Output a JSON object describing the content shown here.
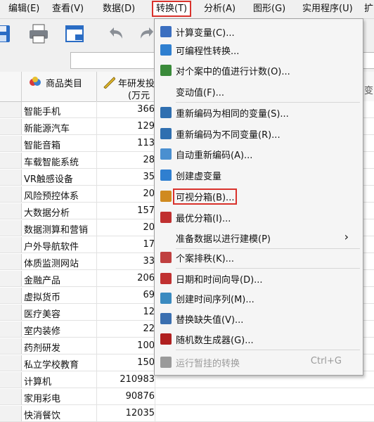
{
  "menubar": {
    "items": [
      {
        "label": "编辑(E)"
      },
      {
        "label": "查看(V)"
      },
      {
        "label": "数据(D)"
      },
      {
        "label": "转换(T)"
      },
      {
        "label": "分析(A)"
      },
      {
        "label": "图形(G)"
      },
      {
        "label": "实用程序(U)"
      },
      {
        "label": "扩"
      }
    ]
  },
  "columns": {
    "c1": {
      "label": "商品类目"
    },
    "c2": {
      "label": "年研发投",
      "sub": "(万元"
    },
    "c3": {
      "label": "变"
    }
  },
  "rows": [
    {
      "category": "智能手机",
      "value": "366"
    },
    {
      "category": "新能源汽车",
      "value": "129"
    },
    {
      "category": "智能音箱",
      "value": "113"
    },
    {
      "category": "车载智能系统",
      "value": "28"
    },
    {
      "category": "VR触感设备",
      "value": "35"
    },
    {
      "category": "风险预控体系",
      "value": "20"
    },
    {
      "category": "大数据分析",
      "value": "157"
    },
    {
      "category": "数据测算和营销",
      "value": "20"
    },
    {
      "category": "户外导航软件",
      "value": "17"
    },
    {
      "category": "体质监测网站",
      "value": "33"
    },
    {
      "category": "金融产品",
      "value": "206"
    },
    {
      "category": "虚拟货币",
      "value": "69"
    },
    {
      "category": "医疗美容",
      "value": "12"
    },
    {
      "category": "室内装修",
      "value": "22"
    },
    {
      "category": "药剂研发",
      "value": "100"
    },
    {
      "category": "私立学校教育",
      "value": "150"
    },
    {
      "category": "计算机",
      "value": "210983"
    },
    {
      "category": "家用彩电",
      "value": "90876"
    },
    {
      "category": "快消餐饮",
      "value": "12035"
    }
  ],
  "transform_menu": {
    "items": [
      {
        "label": "计算变量(C)...",
        "icon": "calculator-icon",
        "color": "#3b6fc0"
      },
      {
        "label": "可编程性转换...",
        "icon": "plus-icon",
        "color": "#2f7fd0"
      },
      {
        "label": "对个案中的值进行计数(O)...",
        "icon": "count-icon",
        "color": "#3a8a3a"
      },
      {
        "label": "变动值(F)...",
        "icon": "",
        "color": ""
      },
      {
        "label": "重新编码为相同的变量(S)...",
        "icon": "recode-same-icon",
        "color": "#2f6fb0"
      },
      {
        "label": "重新编码为不同变量(R)...",
        "icon": "recode-different-icon",
        "color": "#2f6fb0"
      },
      {
        "label": "自动重新编码(A)...",
        "icon": "auto-recode-icon",
        "color": "#4a8fd0"
      },
      {
        "label": "创建虚变量",
        "icon": "plus-icon",
        "color": "#2f7fd0"
      },
      {
        "label": "可视分箱(B)...",
        "icon": "visual-binning-icon",
        "color": "#d08a20"
      },
      {
        "label": "最优分箱(I)...",
        "icon": "optimal-binning-icon",
        "color": "#c03030"
      },
      {
        "label": "准备数据以进行建模(P)",
        "icon": "",
        "color": ""
      },
      {
        "label": "个案排秩(K)...",
        "icon": "rank-cases-icon",
        "color": "#c04040"
      },
      {
        "label": "日期和时间向导(D)...",
        "icon": "calendar-icon",
        "color": "#c03030"
      },
      {
        "label": "创建时间序列(M)...",
        "icon": "time-series-icon",
        "color": "#3a8ac0"
      },
      {
        "label": "替换缺失值(V)...",
        "icon": "replace-missing-icon",
        "color": "#3a6fb0"
      },
      {
        "label": "随机数生成器(G)...",
        "icon": "dice-icon",
        "color": "#b02020"
      },
      {
        "label": "运行暂挂的转换",
        "icon": "run-pending-icon",
        "color": "#9a9a9a"
      }
    ],
    "shortcut": "Ctrl+G",
    "submenu_arrow": "›"
  },
  "accent": "#d9322c"
}
